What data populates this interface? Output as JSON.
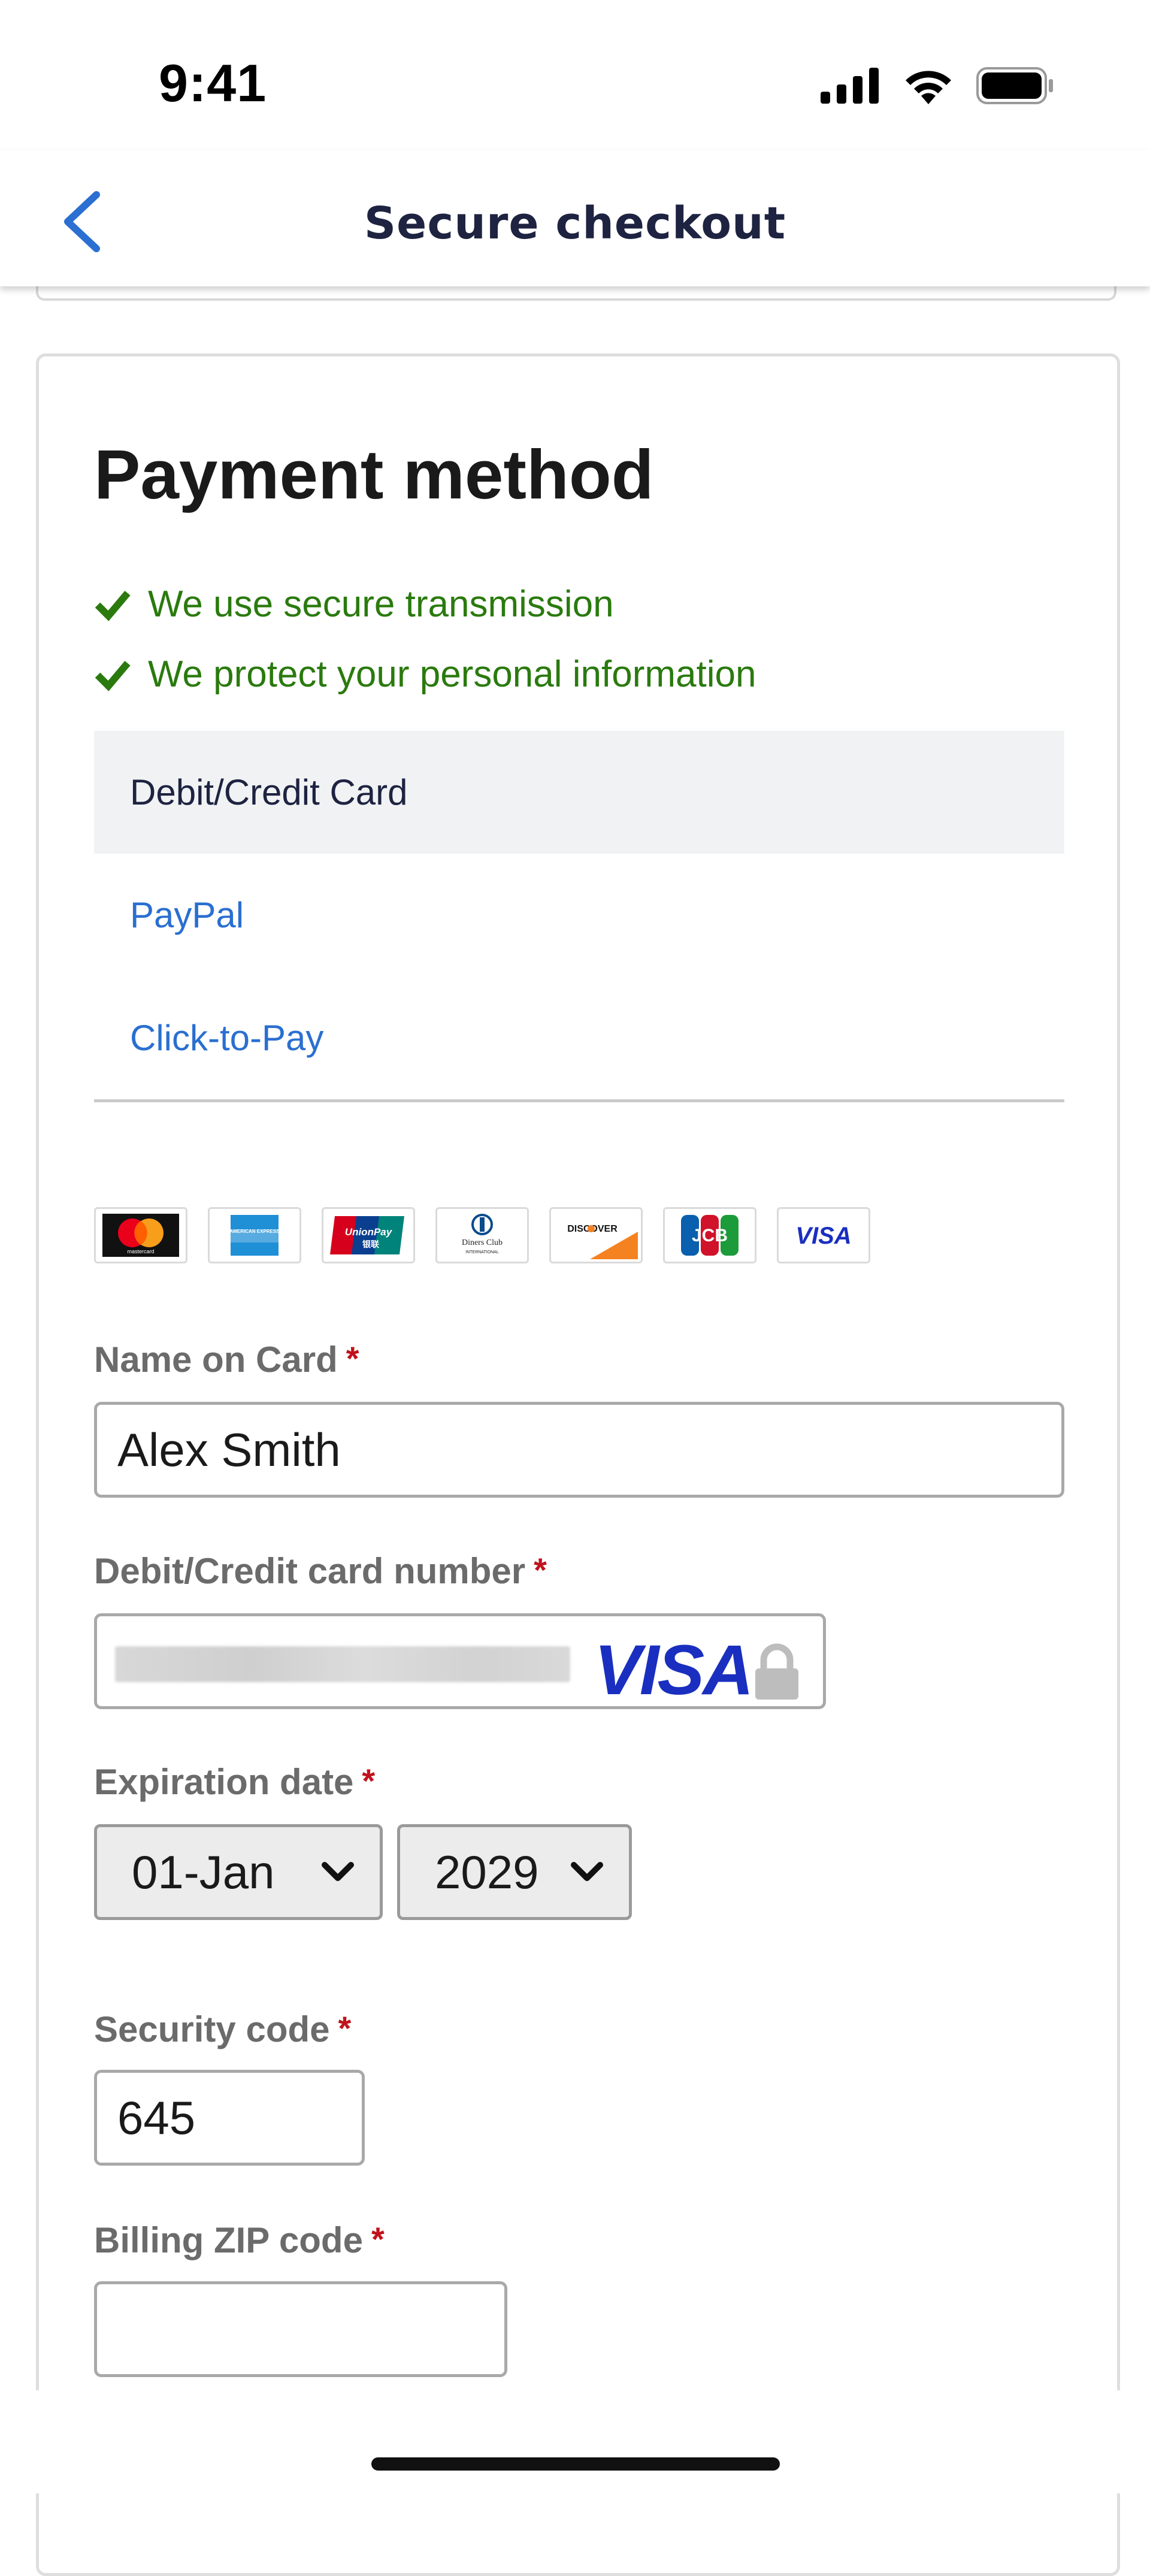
{
  "status_bar": {
    "time": "9:41"
  },
  "nav": {
    "title": "Secure checkout"
  },
  "payment": {
    "title": "Payment method",
    "secure_lines": [
      "We use secure transmission",
      "We protect your personal information"
    ],
    "tabs": [
      {
        "label": "Debit/Credit Card",
        "active": true
      },
      {
        "label": "PayPal",
        "active": false
      },
      {
        "label": "Click-to-Pay",
        "active": false
      }
    ],
    "card_logos": [
      "mastercard",
      "AMERICAN EXPRESS",
      "UnionPay",
      "Diners Club INTERNATIONAL",
      "DISCOVER",
      "JCB",
      "VISA"
    ]
  },
  "form": {
    "name_label": "Name on Card",
    "name_value": "Alex Smith",
    "number_label": "Debit/Credit card number",
    "number_brand": "VISA",
    "expiry_label": "Expiration date",
    "expiry_month": "01-Jan",
    "expiry_year": "2029",
    "cvv_label": "Security code",
    "cvv_value": "645",
    "zip_label": "Billing ZIP code",
    "zip_value": "",
    "required_mark": "*"
  },
  "colors": {
    "accent_blue": "#2a6fd1",
    "secure_green": "#2a7a0e",
    "required_red": "#c0121c",
    "nav_title": "#1d2340"
  },
  "icons": [
    "back-chevron-icon",
    "signal-icon",
    "wifi-icon",
    "battery-icon",
    "checkmark-icon",
    "lock-icon",
    "chevron-down-icon"
  ]
}
